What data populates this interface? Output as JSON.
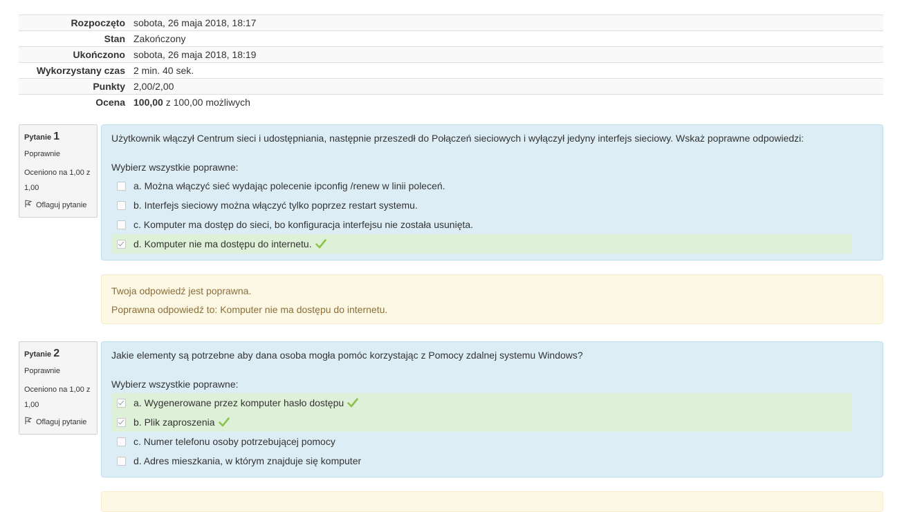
{
  "summary": [
    {
      "label": "Rozpoczęto",
      "value": "sobota, 26 maja 2018, 18:17"
    },
    {
      "label": "Stan",
      "value": "Zakończony"
    },
    {
      "label": "Ukończono",
      "value": "sobota, 26 maja 2018, 18:19"
    },
    {
      "label": "Wykorzystany czas",
      "value": "2 min. 40 sek."
    },
    {
      "label": "Punkty",
      "value": "2,00/2,00"
    },
    {
      "label": "Ocena",
      "value_bold": "100,00",
      "value_rest": " z 100,00 możliwych"
    }
  ],
  "questions": [
    {
      "label": "Pytanie",
      "number": "1",
      "state": "Poprawnie",
      "grade": "Oceniono na 1,00 z 1,00",
      "flag": "Oflaguj pytanie",
      "text": "Użytkownik włączył Centrum sieci i udostępniania, następnie przeszedł do Połączeń sieciowych i wyłączył jedyny interfejs sieciowy. Wskaż poprawne odpowiedzi:",
      "prompt": "Wybierz wszystkie poprawne:",
      "options": [
        {
          "text": "a. Można włączyć sieć wydając polecenie ipconfig /renew w linii poleceń.",
          "checked": false
        },
        {
          "text": "b. Interfejs sieciowy można włączyć tylko poprzez restart systemu.",
          "checked": false
        },
        {
          "text": "c. Komputer ma dostęp do sieci, bo konfiguracja interfejsu nie została usunięta.",
          "checked": false
        },
        {
          "text": "d. Komputer nie ma dostępu do internetu.",
          "checked": true
        }
      ],
      "feedback": {
        "result": "Twoja odpowiedź jest poprawna.",
        "correct": "Poprawna odpowiedź to: Komputer nie ma dostępu do internetu."
      }
    },
    {
      "label": "Pytanie",
      "number": "2",
      "state": "Poprawnie",
      "grade": "Oceniono na 1,00 z 1,00",
      "flag": "Oflaguj pytanie",
      "text": "Jakie elementy są potrzebne aby dana osoba mogła pomóc korzystając z Pomocy zdalnej systemu Windows?",
      "prompt": "Wybierz wszystkie poprawne:",
      "options": [
        {
          "text": "a. Wygenerowane przez komputer hasło dostępu",
          "checked": true
        },
        {
          "text": "b. Plik zaproszenia",
          "checked": true
        },
        {
          "text": "c. Numer telefonu osoby potrzebującej pomocy",
          "checked": false
        },
        {
          "text": "d. Adres mieszkania, w którym znajduje się komputer",
          "checked": false
        }
      ]
    }
  ],
  "colors": {
    "tick": "#8bc34a",
    "info_bg": "#dcedf6",
    "correct_bg": "#dff0d8",
    "feedback_bg": "#fcf8e3"
  },
  "icons": {
    "flag": "flag-icon",
    "tick": "correct-check-icon"
  }
}
